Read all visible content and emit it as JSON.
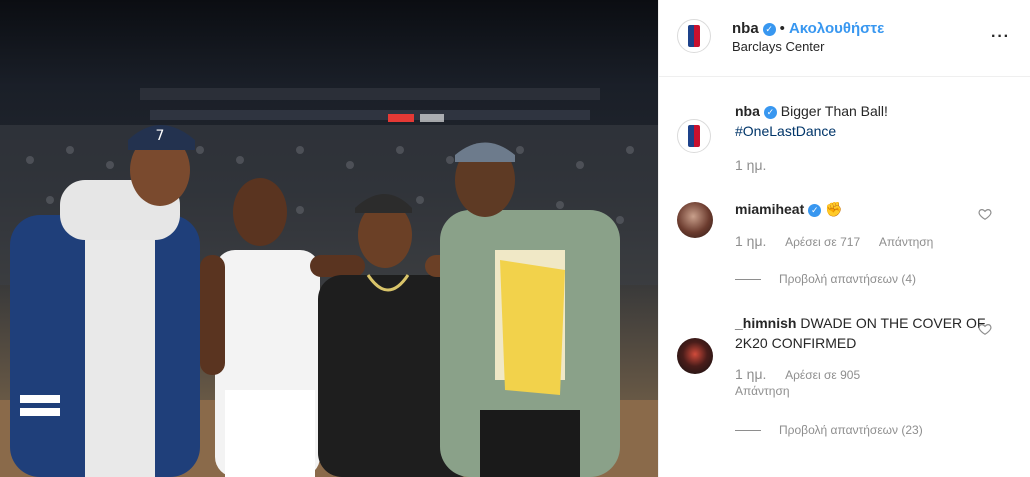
{
  "post": {
    "username": "nba",
    "follow_label": "Ακολουθήστε",
    "location": "Barclays Center",
    "caption": {
      "username": "nba",
      "text": "Bigger Than Ball!",
      "hashtag": "#OneLastDance",
      "time": "1 ημ."
    }
  },
  "comments": [
    {
      "username": "miamiheat",
      "verified": true,
      "text": "✊",
      "time": "1 ημ.",
      "likes": "Αρέσει σε 717",
      "reply": "Απάντηση",
      "view_replies": "Προβολή απαντήσεων (4)"
    },
    {
      "username": "_himnish",
      "verified": false,
      "text": "DWADE ON THE COVER OF 2K20 CONFIRMED",
      "time": "1 ημ.",
      "likes": "Αρέσει σε 905",
      "reply": "Απάντηση",
      "view_replies": "Προβολή απαντήσεων (23)"
    }
  ],
  "colors": {
    "link": "#3897f0",
    "hashtag": "#003569",
    "muted": "#8e8e8e"
  },
  "icons": [
    "nba-logo-icon",
    "verified-icon",
    "more-options-icon",
    "heart-icon"
  ]
}
